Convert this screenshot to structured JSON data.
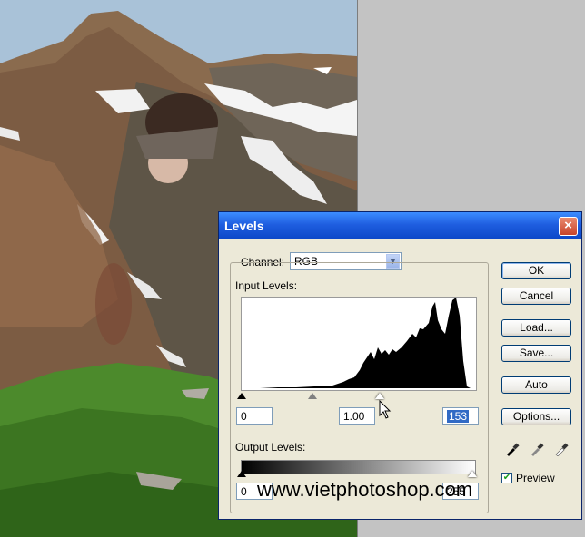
{
  "dialog": {
    "title": "Levels",
    "close_label": "×",
    "channel_label": "Channel:",
    "channel_value": "RGB",
    "input_levels_label": "Input Levels:",
    "input_black": "0",
    "input_gamma": "1.00",
    "input_white": "153",
    "output_levels_label": "Output Levels:",
    "output_black": "0",
    "output_white": "255",
    "buttons": {
      "ok": "OK",
      "cancel": "Cancel",
      "load": "Load...",
      "save": "Save...",
      "auto": "Auto",
      "options": "Options..."
    },
    "preview_label": "Preview",
    "preview_checked": true
  },
  "watermark": "www.vietphotoshop.com",
  "colors": {
    "title_bar": "#0b47c7",
    "dialog_bg": "#ece9d8",
    "selection": "#316ac5"
  }
}
